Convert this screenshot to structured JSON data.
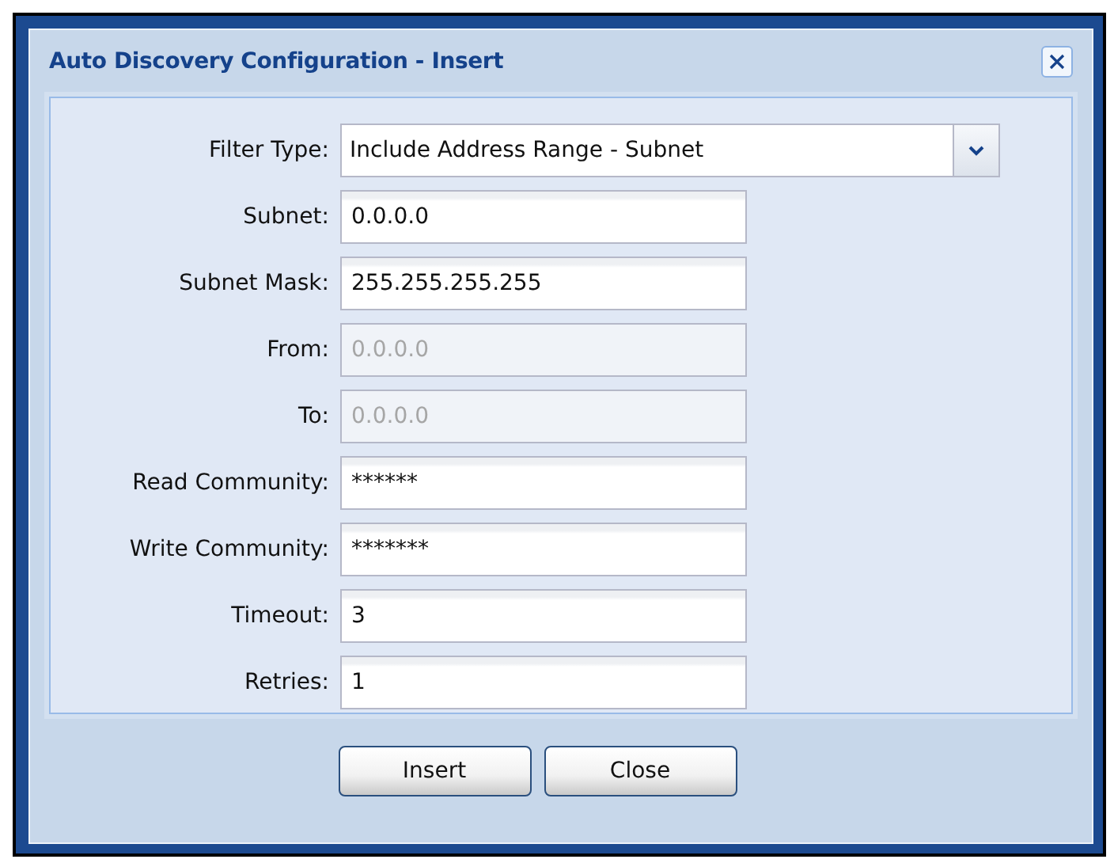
{
  "dialog": {
    "title": "Auto Discovery Configuration - Insert"
  },
  "fields": [
    {
      "label": "Filter Type:",
      "kind": "select",
      "value": "Include Address Range - Subnet",
      "disabled": false
    },
    {
      "label": "Subnet:",
      "kind": "text",
      "value": "0.0.0.0",
      "disabled": false
    },
    {
      "label": "Subnet Mask:",
      "kind": "text",
      "value": "255.255.255.255",
      "disabled": false
    },
    {
      "label": "From:",
      "kind": "text",
      "value": "0.0.0.0",
      "disabled": true
    },
    {
      "label": "To:",
      "kind": "text",
      "value": "0.0.0.0",
      "disabled": true
    },
    {
      "label": "Read Community:",
      "kind": "text",
      "value": "******",
      "disabled": false
    },
    {
      "label": "Write Community:",
      "kind": "text",
      "value": "*******",
      "disabled": false
    },
    {
      "label": "Timeout:",
      "kind": "text",
      "value": "3",
      "disabled": false
    },
    {
      "label": "Retries:",
      "kind": "text",
      "value": "1",
      "disabled": false
    }
  ],
  "buttons": [
    "Insert",
    "Close"
  ]
}
